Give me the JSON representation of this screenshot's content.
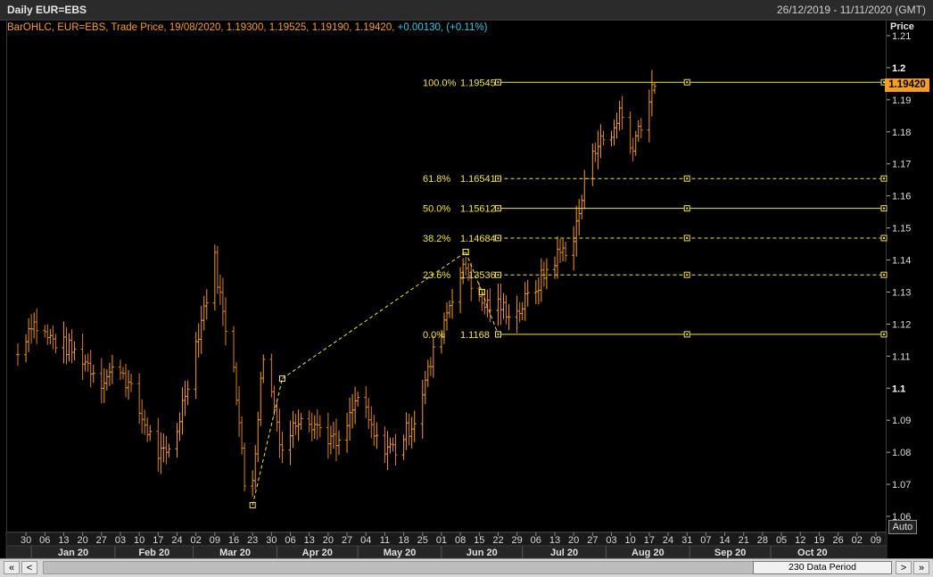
{
  "window": {
    "title": "Daily EUR=EBS",
    "date_range": "26/12/2019 - 11/11/2020 (GMT)"
  },
  "legend": {
    "text": "BarOHLC, EUR=EBS, Trade Price, 19/08/2020, 1.19300, 1.19525, 1.19190, 1.19420,",
    "change": "+0.00130, (+0.11%)"
  },
  "axis": {
    "title": "Price",
    "current_price": "1.19420",
    "auto_label": "Auto"
  },
  "scrollbar": {
    "left_fast": "«",
    "left": "<",
    "right": ">",
    "right_fast": "»",
    "thumb_label": "230 Data Period"
  },
  "colors": {
    "bars": "#f59d25",
    "fib": "#f2e24a",
    "change": "#37c7e4",
    "background": "#000000"
  },
  "chart_data": {
    "type": "bar",
    "subtype": "OHLC",
    "title": "Daily EUR=EBS",
    "ylabel": "Price",
    "ylim": [
      1.055,
      1.215
    ],
    "y_ticks": [
      1.06,
      1.07,
      1.08,
      1.09,
      1.1,
      1.11,
      1.12,
      1.13,
      1.14,
      1.15,
      1.16,
      1.17,
      1.18,
      1.19,
      1.2,
      1.21
    ],
    "y_tick_labels": [
      "1.06",
      "1.07",
      "1.08",
      "1.09",
      "1.1",
      "1.11",
      "1.12",
      "1.13",
      "1.14",
      "1.15",
      "1.16",
      "1.17",
      "1.18",
      "1.19",
      "1.2",
      "1.21"
    ],
    "x_start": "2019-12-26",
    "x_end": "2020-11-11",
    "x_tick_labels": [
      "30",
      "06",
      "13",
      "20",
      "27",
      "03",
      "10",
      "17",
      "24",
      "02",
      "09",
      "16",
      "23",
      "30",
      "06",
      "13",
      "20",
      "27",
      "04",
      "11",
      "18",
      "25",
      "01",
      "08",
      "15",
      "22",
      "29",
      "06",
      "13",
      "20",
      "27",
      "03",
      "10",
      "17",
      "24",
      "31",
      "07",
      "14",
      "21",
      "28",
      "05",
      "12",
      "19",
      "26",
      "02",
      "09"
    ],
    "month_labels": [
      "Jan 20",
      "Feb 20",
      "Mar 20",
      "Apr 20",
      "May 20",
      "Jun 20",
      "Jul 20",
      "Aug 20",
      "Sep 20",
      "Oct 20"
    ],
    "last_bar": {
      "date": "2020-08-19",
      "open": 1.193,
      "high": 1.19525,
      "low": 1.1919,
      "close": 1.1942
    },
    "series_points": [
      [
        "2019-12-27",
        1.1105
      ],
      [
        "2020-01-01",
        1.121
      ],
      [
        "2020-01-07",
        1.1158
      ],
      [
        "2020-01-13",
        1.1133
      ],
      [
        "2020-01-20",
        1.1095
      ],
      [
        "2020-01-27",
        1.1025
      ],
      [
        "2020-02-03",
        1.107
      ],
      [
        "2020-02-10",
        1.0925
      ],
      [
        "2020-02-17",
        1.0795
      ],
      [
        "2020-02-20",
        1.0785
      ],
      [
        "2020-02-24",
        1.0875
      ],
      [
        "2020-03-02",
        1.114
      ],
      [
        "2020-03-09",
        1.14
      ],
      [
        "2020-03-12",
        1.123
      ],
      [
        "2020-03-16",
        1.1085
      ],
      [
        "2020-03-20",
        1.0695
      ],
      [
        "2020-03-23",
        1.0725
      ],
      [
        "2020-03-27",
        1.111
      ],
      [
        "2020-04-03",
        1.081
      ],
      [
        "2020-04-10",
        1.093
      ],
      [
        "2020-04-17",
        1.0875
      ],
      [
        "2020-04-24",
        1.0815
      ],
      [
        "2020-05-01",
        1.0975
      ],
      [
        "2020-05-08",
        1.083
      ],
      [
        "2020-05-15",
        1.081
      ],
      [
        "2020-05-22",
        1.0905
      ],
      [
        "2020-05-29",
        1.1105
      ],
      [
        "2020-06-05",
        1.1295
      ],
      [
        "2020-06-10",
        1.138
      ],
      [
        "2020-06-15",
        1.1265
      ],
      [
        "2020-06-22",
        1.1255
      ],
      [
        "2020-06-29",
        1.1235
      ],
      [
        "2020-07-06",
        1.1315
      ],
      [
        "2020-07-13",
        1.1405
      ],
      [
        "2020-07-20",
        1.1465
      ],
      [
        "2020-07-27",
        1.1755
      ],
      [
        "2020-08-03",
        1.1785
      ],
      [
        "2020-08-06",
        1.187
      ],
      [
        "2020-08-10",
        1.175
      ],
      [
        "2020-08-14",
        1.183
      ],
      [
        "2020-08-19",
        1.1942
      ]
    ],
    "fibonacci": {
      "levels": [
        {
          "label": "100.0%",
          "price": "1.19545",
          "value": 1.19545
        },
        {
          "label": "61.8%",
          "price": "1.16541",
          "value": 1.16541
        },
        {
          "label": "50.0%",
          "price": "1.15612",
          "value": 1.15612
        },
        {
          "label": "38.2%",
          "price": "1.14684",
          "value": 1.14684
        },
        {
          "label": "23.6%",
          "price": "1.13536",
          "value": 1.13536
        },
        {
          "label": "0.0%",
          "price": "1.1168",
          "value": 1.1168
        }
      ]
    },
    "trendlines": [
      {
        "from": [
          "2020-03-23",
          1.0635
        ],
        "to": [
          "2020-04-03",
          1.103
        ]
      },
      {
        "from": [
          "2020-04-03",
          1.103
        ],
        "to": [
          "2020-06-10",
          1.1425
        ]
      },
      {
        "from": [
          "2020-06-10",
          1.1425
        ],
        "to": [
          "2020-06-16",
          1.13
        ]
      },
      {
        "from": [
          "2020-06-16",
          1.13
        ],
        "to": [
          "2020-06-22",
          1.1168
        ]
      }
    ]
  }
}
